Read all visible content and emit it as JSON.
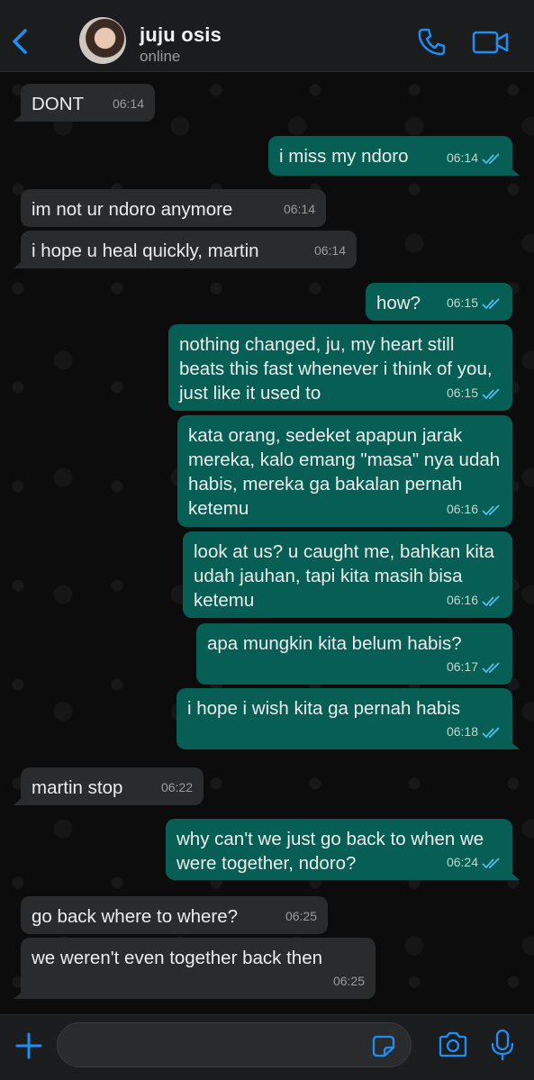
{
  "header": {
    "contact_name": "juju osis",
    "status": "online"
  },
  "colors": {
    "accent": "#1f8ef1",
    "outgoing_bubble": "#075e54",
    "incoming_bubble": "#2a2b2d",
    "read_ticks": "#53bdeb"
  },
  "messages": [
    {
      "dir": "in",
      "text": "DONT",
      "time": "06:14"
    },
    {
      "dir": "out",
      "text": "i miss my ndoro",
      "time": "06:14"
    },
    {
      "dir": "in",
      "text": "im not ur ndoro anymore",
      "time": "06:14"
    },
    {
      "dir": "in",
      "text": "i hope u heal quickly, martin",
      "time": "06:14"
    },
    {
      "dir": "out",
      "text": "how?",
      "time": "06:15"
    },
    {
      "dir": "out",
      "text": "nothing changed, ju, my heart still beats this fast whenever i think of you, just like it used to",
      "time": "06:15"
    },
    {
      "dir": "out",
      "text": "kata orang, sedeket apapun jarak mereka, kalo emang \"masa\" nya udah habis, mereka ga bakalan pernah ketemu",
      "time": "06:16"
    },
    {
      "dir": "out",
      "text": "look at us? u caught me, bahkan kita udah jauhan, tapi kita masih bisa ketemu",
      "time": "06:16"
    },
    {
      "dir": "out",
      "text": "apa mungkin kita belum habis?",
      "time": "06:17"
    },
    {
      "dir": "out",
      "text": "i hope i wish kita ga pernah habis",
      "time": "06:18"
    },
    {
      "dir": "in",
      "text": "martin stop",
      "time": "06:22"
    },
    {
      "dir": "out",
      "text": "why can't we just go back to when we were together, ndoro?",
      "time": "06:24"
    },
    {
      "dir": "in",
      "text": "go back where to where?",
      "time": "06:25"
    },
    {
      "dir": "in",
      "text": "we weren't even together back then",
      "time": "06:25"
    }
  ],
  "composer": {
    "placeholder": ""
  }
}
